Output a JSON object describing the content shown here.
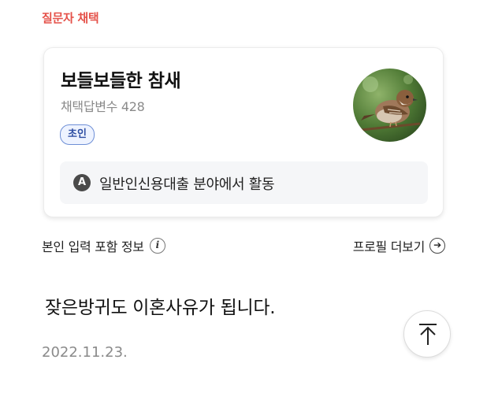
{
  "section": {
    "label": "질문자 채택"
  },
  "profile": {
    "name": "보들보들한 참새",
    "answer_count": "채택답변수 428",
    "grade": "초인",
    "field_icon_letter": "A",
    "field": "일반인신용대출 분야에서 활동",
    "avatar_icon": "sparrow-photo"
  },
  "info": {
    "self_info_label": "본인 입력 포함 정보",
    "info_icon": "i",
    "more_profile_label": "프로필 더보기",
    "more_icon": "➔"
  },
  "answer": {
    "text": "잦은방귀도 이혼사유가 됩니다.",
    "date": "2022.11.23."
  },
  "colors": {
    "accent_red": "#e5524a",
    "badge_blue": "#2f4fa3"
  }
}
